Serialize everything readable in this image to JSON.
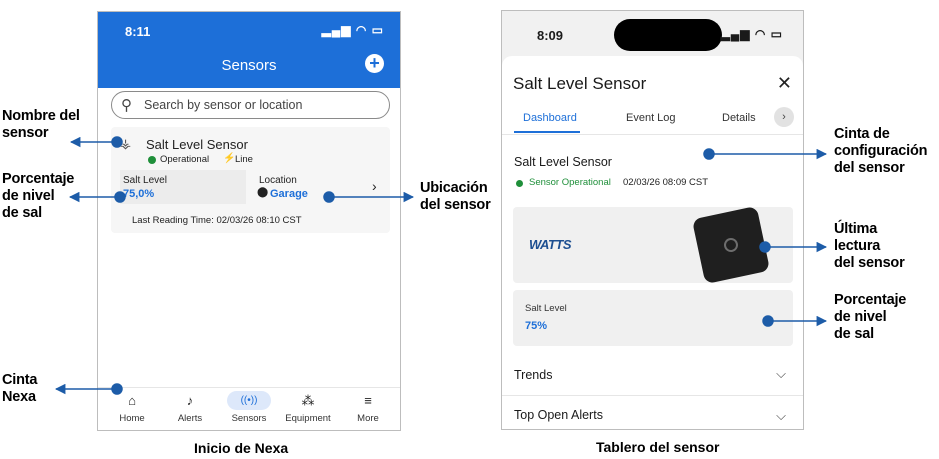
{
  "phone1": {
    "time": "8:11",
    "status": "▂▄▆ ◠ ▭",
    "header_title": "Sensors",
    "add_label": "+",
    "search_placeholder": "Search by sensor or location",
    "card": {
      "name": "Salt Level Sensor",
      "status": "Operational",
      "power": "Line",
      "salt_label": "Salt Level",
      "salt_value": "75,0%",
      "location_label": "Location",
      "location_value": "Garage",
      "last_reading": "Last Reading Time:  02/03/26 08:10 CST"
    },
    "tabs": [
      {
        "label": "Home",
        "icon": "home-icon"
      },
      {
        "label": "Alerts",
        "icon": "bell-icon"
      },
      {
        "label": "Sensors",
        "icon": "sensor-icon"
      },
      {
        "label": "Equipment",
        "icon": "equipment-icon"
      },
      {
        "label": "More",
        "icon": "menu-icon"
      }
    ]
  },
  "phone2": {
    "time": "8:09",
    "status": "▂▄▆ ◠ ▭",
    "title": "Salt Level Sensor",
    "close_label": "✕",
    "tabs": {
      "dashboard": "Dashboard",
      "event_log": "Event Log",
      "details": "Details"
    },
    "section_title": "Salt Level Sensor",
    "status_text": "Sensor Operational",
    "status_time": "02/03/26 08:09 CST",
    "logo": "WATTS",
    "salt_label": "Salt Level",
    "salt_value": "75%",
    "trends": "Trends",
    "top_alerts": "Top Open Alerts"
  },
  "annotations": {
    "nombre": [
      "Nombre del",
      "sensor"
    ],
    "porcentaje_left": [
      "Porcentaje",
      "de nivel",
      "de sal"
    ],
    "cinta_nexa": [
      "Cinta",
      "Nexa"
    ],
    "ubicacion": [
      "Ubicación",
      "del sensor"
    ],
    "cinta_config": [
      "Cinta de",
      "configuración",
      "del sensor"
    ],
    "ultima": [
      "Última",
      "lectura",
      "del sensor"
    ],
    "porcentaje_right": [
      "Porcentaje",
      "de nivel",
      "de sal"
    ]
  },
  "captions": {
    "left": "Inicio de Nexa",
    "right": "Tablero del sensor"
  },
  "colors": {
    "brand_blue": "#1d6fd8",
    "operational_green": "#1f8f3a",
    "callout_blue": "#1d5ca8"
  }
}
